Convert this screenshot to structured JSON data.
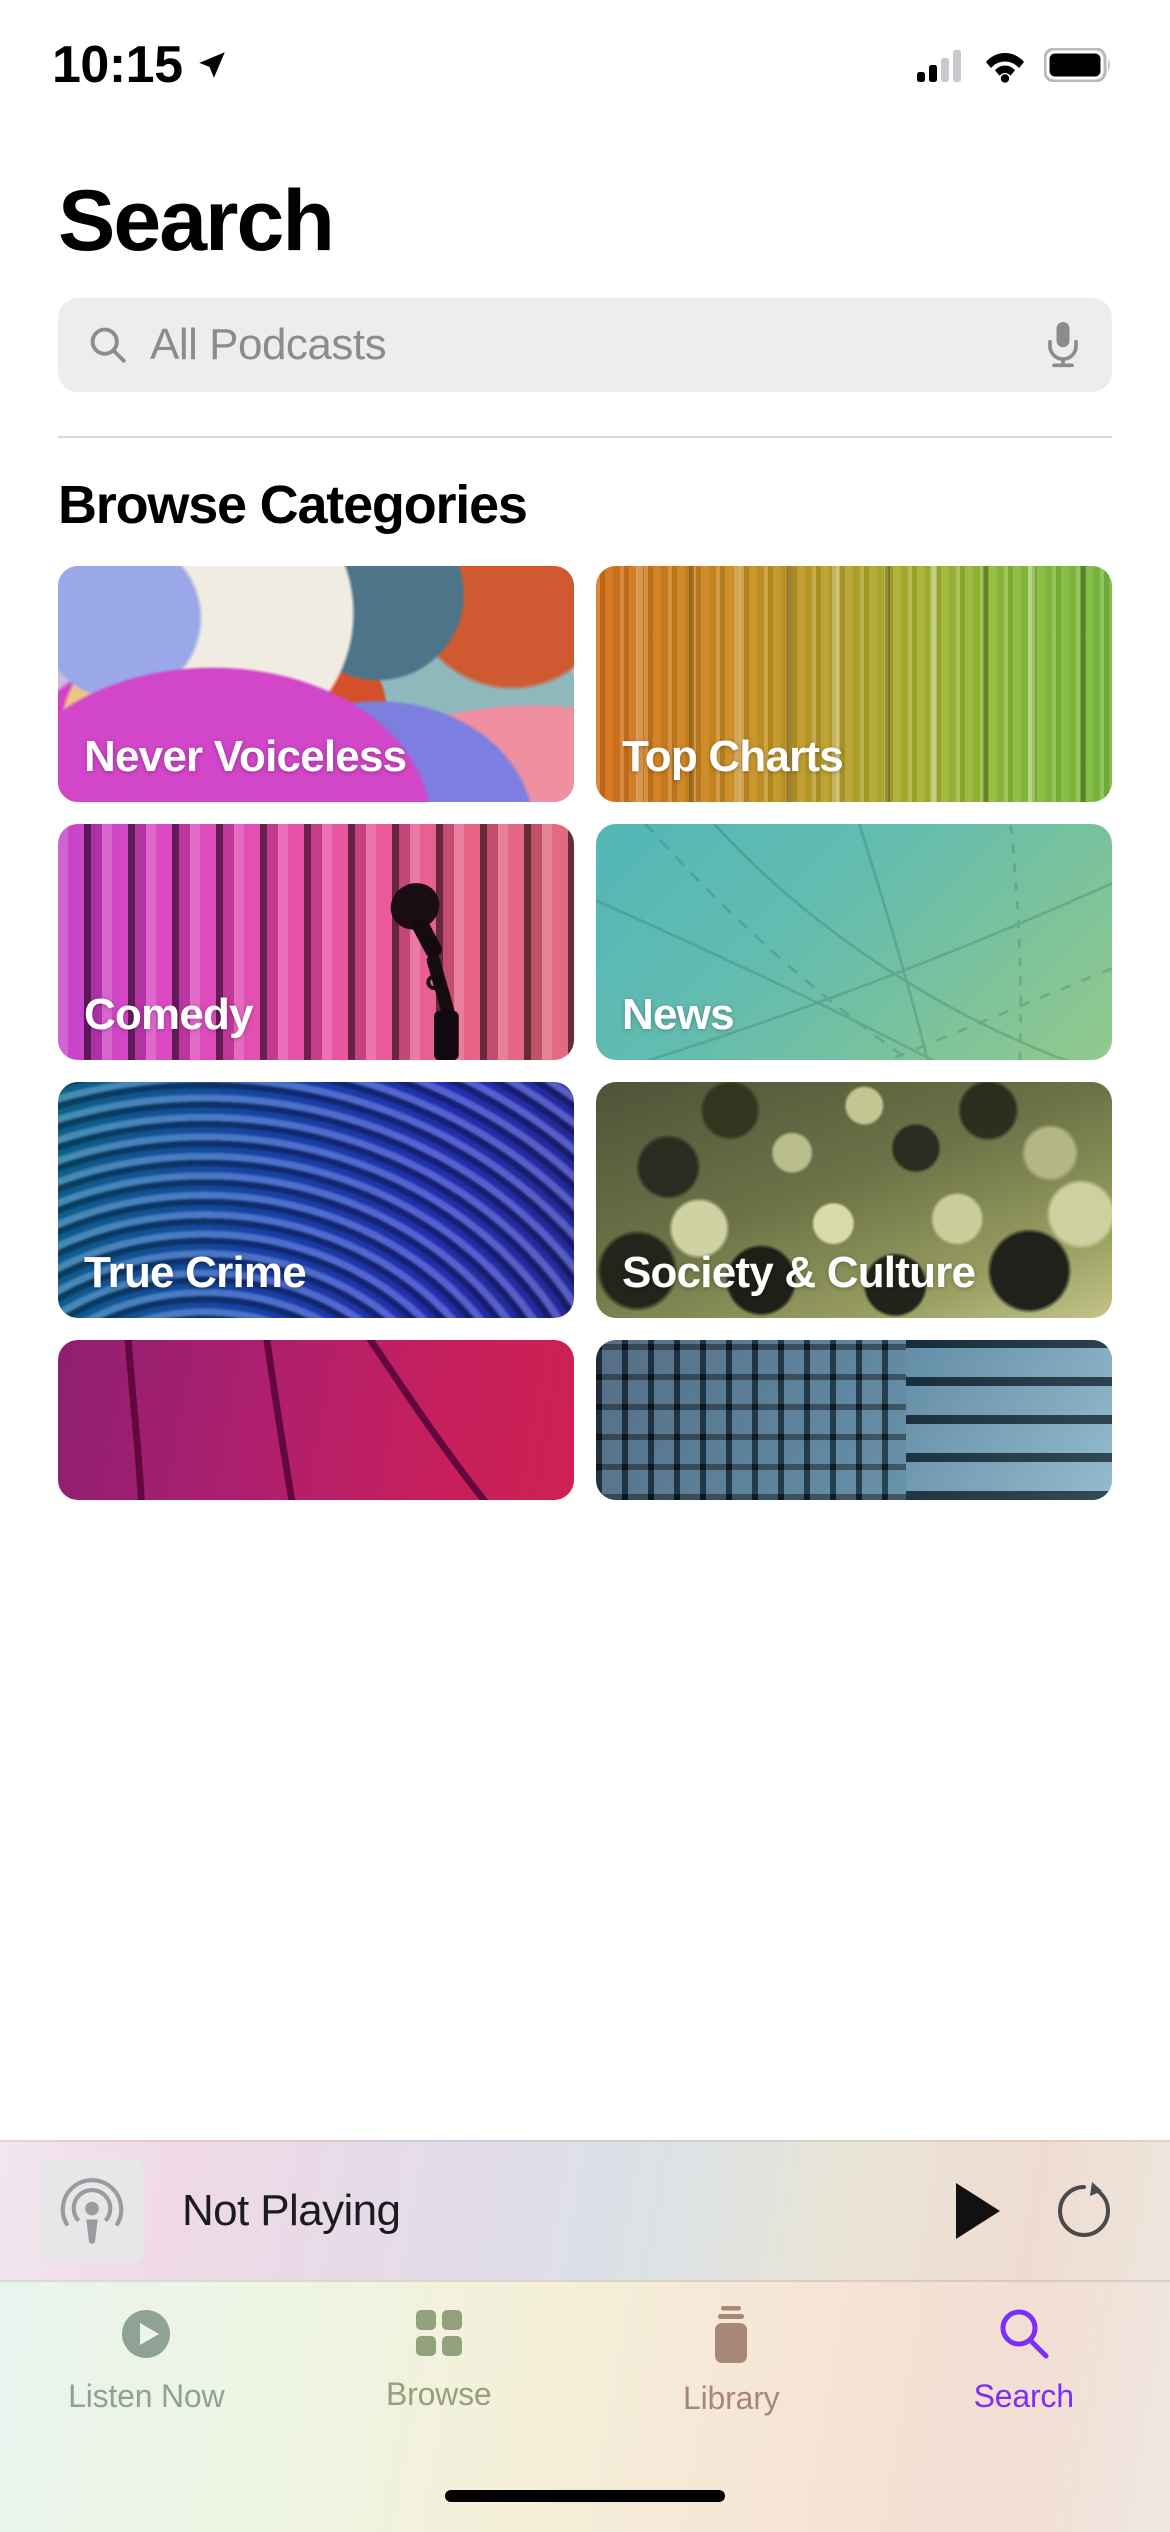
{
  "status_bar": {
    "time": "10:15",
    "location_icon": "location-arrow-icon",
    "cellular_icon": "cellular-signal-icon",
    "wifi_icon": "wifi-icon",
    "battery_icon": "battery-full-icon",
    "signal_bars_filled": 2,
    "signal_bars_total": 4
  },
  "header": {
    "title": "Search"
  },
  "search": {
    "placeholder": "All Podcasts",
    "value": "",
    "search_icon": "search-icon",
    "mic_icon": "microphone-icon",
    "field_background": "#EDEDED",
    "placeholder_color": "#8B8B90"
  },
  "browse": {
    "section_title": "Browse Categories",
    "tiles": [
      {
        "label": "Never Voiceless",
        "art": "abstract-collage",
        "art_class": "art-voiceless"
      },
      {
        "label": "Top Charts",
        "art": "vertical-bars-orange-green",
        "art_class": "art-charts"
      },
      {
        "label": "Comedy",
        "art": "pink-curtain-microphone",
        "art_class": "art-comedy"
      },
      {
        "label": "News",
        "art": "teal-globe",
        "art_class": "art-news"
      },
      {
        "label": "True Crime",
        "art": "blue-fingerprint",
        "art_class": "art-crime"
      },
      {
        "label": "Society & Culture",
        "art": "olive-crowd",
        "art_class": "art-society"
      },
      {
        "label": "",
        "art": "magenta-basketball",
        "art_class": "art-sports"
      },
      {
        "label": "",
        "art": "blue-office-building",
        "art_class": "art-business"
      }
    ]
  },
  "mini_player": {
    "status_text": "Not Playing",
    "artwork_icon": "podcast-logo-icon",
    "play_icon": "play-icon",
    "skip_forward_icon": "skip-forward-icon"
  },
  "tab_bar": {
    "active_tab": "Search",
    "active_color": "#7B2FF7",
    "inactive_color": "#8E9A8F",
    "tabs": [
      {
        "label": "Listen Now",
        "icon": "listen-now-icon",
        "active": false,
        "color": "#8FA294"
      },
      {
        "label": "Browse",
        "icon": "browse-grid-icon",
        "active": false,
        "color": "#93A27C"
      },
      {
        "label": "Library",
        "icon": "library-icon",
        "active": false,
        "color": "#A78878"
      },
      {
        "label": "Search",
        "icon": "search-icon",
        "active": true,
        "color": "#7B2FF7"
      }
    ]
  }
}
